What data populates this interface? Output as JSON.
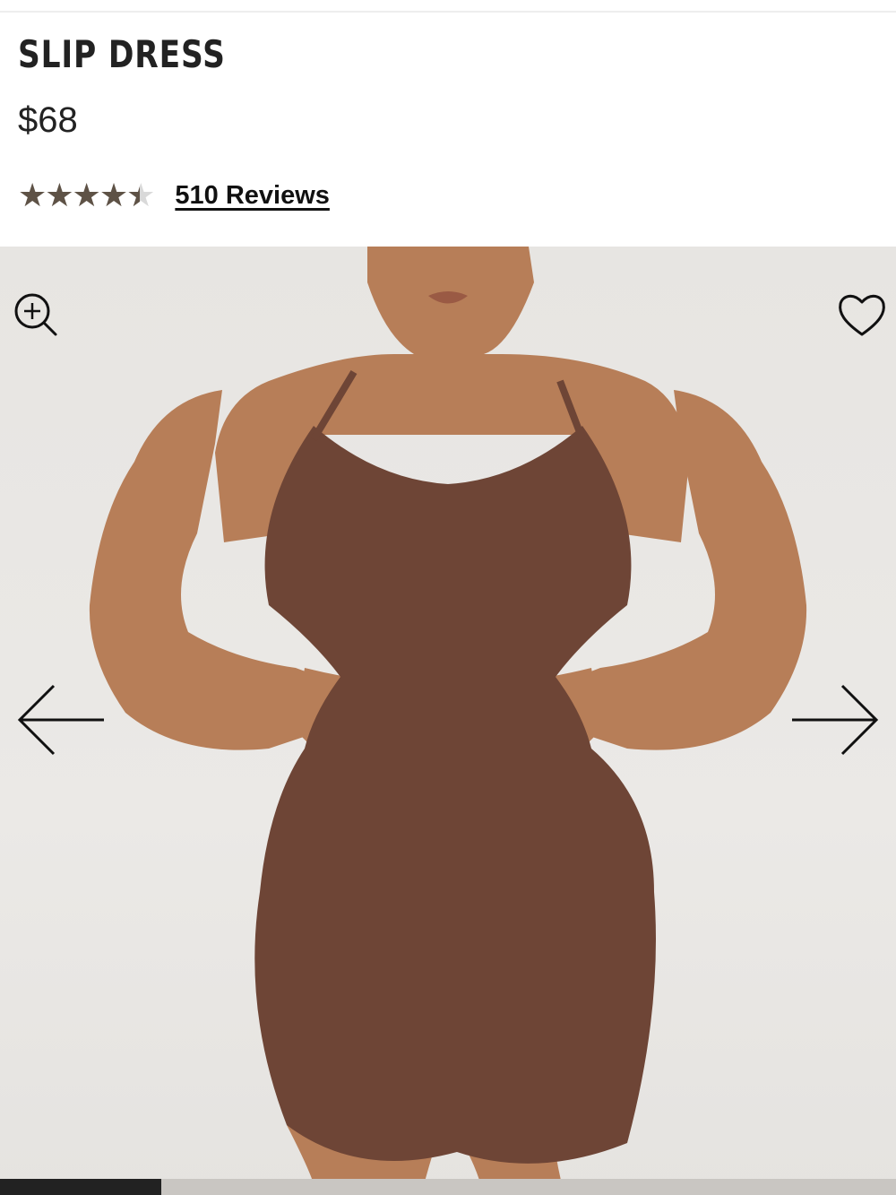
{
  "product": {
    "title": "SLIP DRESS",
    "price": "$68",
    "rating": 4.5,
    "rating_max": 5,
    "reviews_label": "510 Reviews"
  },
  "gallery": {
    "image_alt": "Model wearing a brown slip dress",
    "zoom_icon": "zoom-in-icon",
    "favorite_icon": "heart-outline-icon",
    "prev_icon": "arrow-left-icon",
    "next_icon": "arrow-right-icon",
    "progress": 0.18
  },
  "colors": {
    "star_filled": "#5e5246",
    "star_empty": "#d9d9d9",
    "dress": "#6e4536",
    "skin": "#b77e58",
    "progress": "#222222"
  }
}
